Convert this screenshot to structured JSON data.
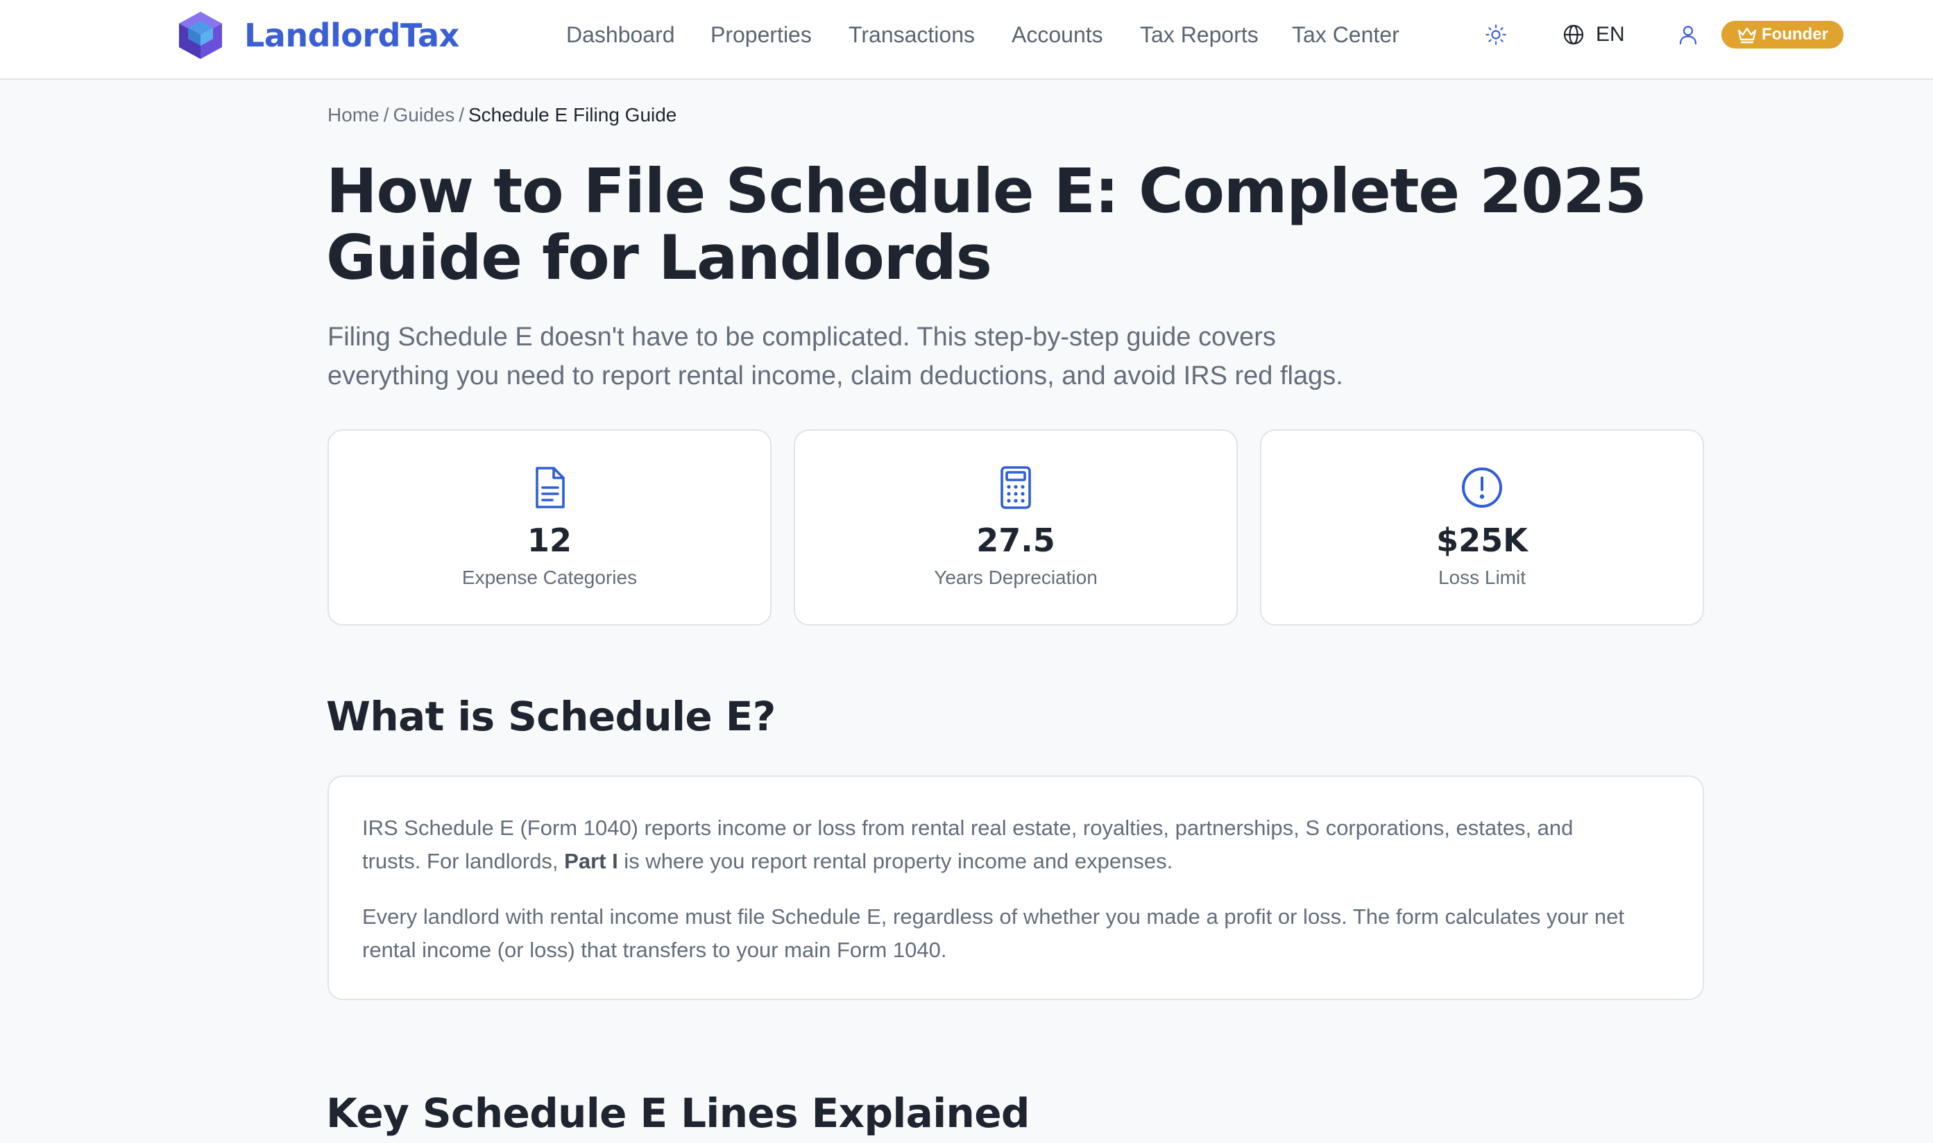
{
  "brand": {
    "name": "LandlordTax",
    "logo_icon": "hexagon-cube-logo",
    "accent": "#3a5fd4"
  },
  "nav": {
    "items": [
      {
        "label": "Dashboard"
      },
      {
        "label": "Properties"
      },
      {
        "label": "Transactions"
      },
      {
        "label": "Accounts"
      },
      {
        "label": "Tax Reports"
      },
      {
        "label": "Tax Center"
      }
    ],
    "theme_icon": "sun-icon",
    "language_icon": "globe-icon",
    "language": "EN",
    "user_icon": "user-icon",
    "badge": {
      "label": "Founder",
      "icon": "crown-icon",
      "color": "#e0a32e"
    }
  },
  "breadcrumb": {
    "items": [
      {
        "label": "Home"
      },
      {
        "label": "Guides"
      },
      {
        "label": "Schedule E Filing Guide"
      }
    ],
    "separator": "/"
  },
  "hero": {
    "title_line1": "How to File Schedule E: Complete 2025",
    "title_line2": "Guide for Landlords",
    "subtitle_line1": "Filing Schedule E doesn't have to be complicated. This step-by-step guide covers",
    "subtitle_line2": "everything you need to report rental income, claim deductions, and avoid IRS red flags."
  },
  "stats": [
    {
      "value": "12",
      "label": "Expense Categories",
      "icon": "document-icon"
    },
    {
      "value": "27.5",
      "label": "Years Depreciation",
      "icon": "calculator-icon"
    },
    {
      "value": "$25K",
      "label": "Loss Limit",
      "icon": "alert-circle-icon"
    }
  ],
  "what_is": {
    "heading": "What is Schedule E?",
    "para1_before": "IRS Schedule E (Form 1040) reports income or loss from rental real estate, royalties, partnerships, S corporations, estates, and",
    "para1_line2_a": "trusts. For landlords, ",
    "para1_bold": "Part I",
    "para1_line2_b": " is where you report rental property income and expenses.",
    "para2_line1": "Every landlord with rental income must file Schedule E, regardless of whether you made a profit or loss. The form calculates your net",
    "para2_line2": "rental income (or loss) that transfers to your main Form 1040."
  },
  "key_lines": {
    "heading": "Key Schedule E Lines Explained"
  }
}
